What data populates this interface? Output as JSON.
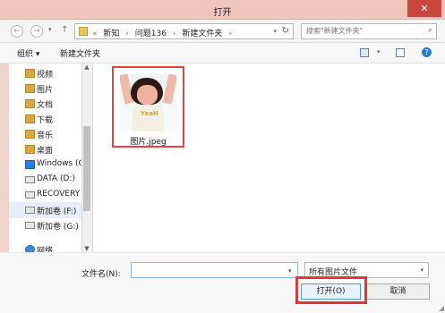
{
  "window": {
    "title": "打开",
    "close": "✕"
  },
  "nav": {
    "back": "←",
    "forward": "→",
    "history": "▾",
    "up": "↑",
    "breadcrumbs": [
      "«",
      "新知",
      "›",
      "问题136",
      "›",
      "新建文件夹",
      "›"
    ],
    "address_dropdown": "▾",
    "refresh": "↻",
    "search_placeholder": "搜索\"新建文件夹\"",
    "search_icon": "⌕"
  },
  "toolbar": {
    "organize": "组织 ▾",
    "new_folder": "新建文件夹",
    "view_dropdown": "▾",
    "help": "?"
  },
  "sidebar": {
    "items": [
      {
        "label": "视频",
        "icon": "folder-icon"
      },
      {
        "label": "图片",
        "icon": "folder-icon"
      },
      {
        "label": "文档",
        "icon": "folder-icon"
      },
      {
        "label": "下载",
        "icon": "download-icon"
      },
      {
        "label": "音乐",
        "icon": "music-icon"
      },
      {
        "label": "桌面",
        "icon": "desktop-icon"
      },
      {
        "label": "Windows (C",
        "icon": "windows-drive-icon"
      },
      {
        "label": "DATA (D:)",
        "icon": "drive-icon"
      },
      {
        "label": "RECOVERY (",
        "icon": "drive-icon"
      },
      {
        "label": "新加卷 (F:)",
        "icon": "drive-icon"
      },
      {
        "label": "新加卷 (G:)",
        "icon": "drive-icon"
      },
      {
        "label": "网络",
        "icon": "network-icon"
      }
    ]
  },
  "file": {
    "name": "图片.jpeg",
    "shirt_text": "YeaH"
  },
  "footer": {
    "filename_label": "文件名(N):",
    "filename_value": "",
    "filter": "所有图片文件",
    "open": "打开(O)",
    "cancel": "取消"
  },
  "colors": {
    "titlebar": "#f0c5bd",
    "close": "#c9463d",
    "highlight": "#e24343"
  }
}
